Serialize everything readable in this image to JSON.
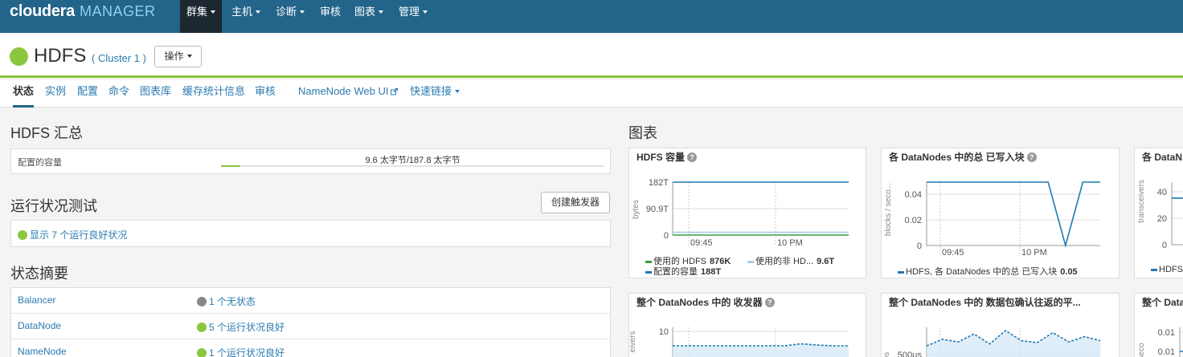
{
  "topnav": {
    "logo_brand": "cloudera",
    "logo_product": "MANAGER",
    "items": [
      {
        "label": "群集",
        "dropdown": true,
        "active": true
      },
      {
        "label": "主机",
        "dropdown": true
      },
      {
        "label": "诊断",
        "dropdown": true
      },
      {
        "label": "审核",
        "dropdown": false
      },
      {
        "label": "图表",
        "dropdown": true
      },
      {
        "label": "管理",
        "dropdown": true
      }
    ]
  },
  "header": {
    "service_name": "HDFS",
    "cluster": "( Cluster 1 )",
    "actions_label": "操作",
    "status_color": "#8cc63f"
  },
  "tabs": [
    {
      "label": "状态",
      "active": true
    },
    {
      "label": "实例"
    },
    {
      "label": "配置"
    },
    {
      "label": "命令"
    },
    {
      "label": "图表库"
    },
    {
      "label": "缓存统计信息"
    },
    {
      "label": "审核"
    },
    {
      "label": "NameNode Web UI",
      "external": true
    },
    {
      "label": "快速链接",
      "dropdown": true
    }
  ],
  "summary": {
    "title": "HDFS 汇总",
    "capacity_label": "配置的容量",
    "capacity_value": "9.6 太字节/187.8 太字节",
    "capacity_fraction": 0.051
  },
  "health": {
    "title": "运行状况测试",
    "create_trigger": "创建触发器",
    "show_healthy": "显示 7 个运行良好状况"
  },
  "status_summary": {
    "title": "状态摘要",
    "rows": [
      {
        "name": "Balancer",
        "status": "1 个无状态",
        "dot": "gray"
      },
      {
        "name": "DataNode",
        "status": "5 个运行状况良好",
        "dot": "green"
      },
      {
        "name": "NameNode",
        "status": "1 个运行状况良好",
        "dot": "green"
      }
    ]
  },
  "charts_title": "图表",
  "chart_data": [
    {
      "type": "line",
      "title": "HDFS 容量",
      "ylabel": "bytes",
      "yticks": [
        "182T",
        "90.9T",
        "0"
      ],
      "xticks": [
        "09:45",
        "10 PM"
      ],
      "series": [
        {
          "name": "使用的 HDFS",
          "value": "876K",
          "color": "#3c9a3c",
          "values": [
            5e-06,
            5e-06
          ]
        },
        {
          "name": "使用的非 HD...",
          "value": "9.6T",
          "color": "#a6cee3",
          "values": [
            9.6,
            9.6
          ]
        },
        {
          "name": "配置的容量",
          "value": "188T",
          "color": "#1f78b4",
          "values": [
            188,
            188
          ]
        }
      ],
      "ylim": [
        0,
        188
      ]
    },
    {
      "type": "line",
      "title": "各 DataNodes 中的总 已写入块",
      "ylabel": "blocks / seco...",
      "yticks": [
        "0.04",
        "0.02",
        "0"
      ],
      "xticks": [
        "09:45",
        "10 PM"
      ],
      "series": [
        {
          "name": "HDFS, 各 DataNodes 中的总 已写入块",
          "value": "0.05",
          "color": "#1f78b4",
          "values": [
            0.05,
            0.05,
            0.05,
            0.05,
            0.05,
            0.05,
            0.05,
            0.05,
            0,
            0.05,
            0.05
          ]
        }
      ],
      "ylim": [
        0,
        0.05
      ]
    },
    {
      "type": "line",
      "title": "各 DataN",
      "ylabel": "transceivers",
      "yticks": [
        "40",
        "20",
        "0"
      ],
      "series": [
        {
          "name": "HDFS",
          "color": "#1f78b4",
          "values": [
            44,
            44
          ]
        }
      ],
      "ylim": [
        0,
        50
      ]
    },
    {
      "type": "area",
      "title": "整个 DataNodes 中的 收发器",
      "ylabel": "eivers",
      "yticks": [
        "10"
      ],
      "series": [
        {
          "color": "#1f78b4",
          "values": [
            7,
            7,
            7,
            7,
            7,
            7,
            7,
            7,
            7.5,
            7.2,
            7,
            7
          ]
        }
      ],
      "ylim": [
        0,
        12
      ]
    },
    {
      "type": "area",
      "title": "整个 DataNodes 中的 数据包确认往返的平...",
      "ylabel": "os",
      "yticks": [
        "500μs"
      ],
      "series": [
        {
          "color": "#1f78b4",
          "values": [
            420,
            520,
            480,
            600,
            450,
            650,
            500,
            470,
            620,
            480,
            560,
            500
          ]
        }
      ],
      "ylim": [
        0,
        700
      ]
    },
    {
      "type": "line",
      "title": "整个 DataN",
      "ylabel": "seco",
      "yticks": [
        "0.01",
        "0.01"
      ],
      "series": [
        {
          "color": "#1f78b4",
          "values": [
            0.01,
            0.01
          ]
        }
      ],
      "ylim": [
        0,
        0.02
      ]
    }
  ]
}
